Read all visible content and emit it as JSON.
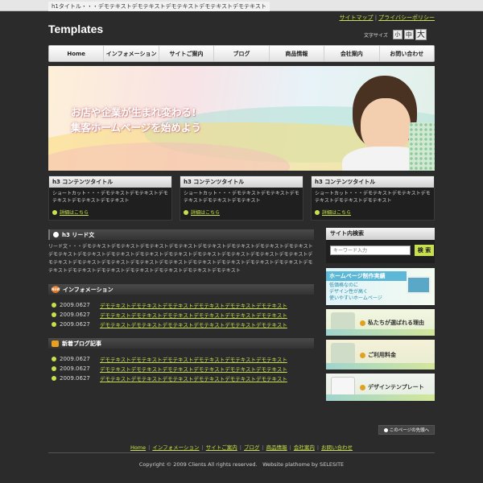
{
  "top_bar": {
    "h1_text": "h1タイトル・・・デモテキストデモテキストデモテキストデモテキストデモテキスト"
  },
  "site": {
    "logo": "Templates"
  },
  "utility_links": {
    "sitemap": "サイトマップ",
    "privacy": "プライバシーポリシー",
    "separator": "|"
  },
  "font_size": {
    "label": "文字サイズ",
    "small": "小",
    "medium": "中",
    "large": "大"
  },
  "global_nav": [
    "Home",
    "インフォメーション",
    "サイトご案内",
    "ブログ",
    "商品情報",
    "会社案内",
    "お問い合わせ"
  ],
  "hero": {
    "line1": "お店や企業が生まれ変わる!",
    "line2": "集客ホームページを始めよう"
  },
  "content_boxes": [
    {
      "title": "h3 コンテンツタイトル",
      "text": "ショートカット・・・デモテキストデモテキストデモテキストデモテキストデモテキスト",
      "more": "詳細はこちら"
    },
    {
      "title": "h3 コンテンツタイトル",
      "text": "ショートカット・・・デモテキストデモテキストデモテキストデモテキストデモテキスト",
      "more": "詳細はこちら"
    },
    {
      "title": "h3 コンテンツタイトル",
      "text": "ショートカット・・・デモテキストデモテキストデモテキストデモテキストデモテキスト",
      "more": "詳細はこちら"
    }
  ],
  "lead": {
    "heading": "h3 リード文",
    "text": "リード文・・・デモテキストデモテキストデモテキストデモテキストデモテキストデモテキストデモテキストデモテキストデモテキストデモテキストデモテキストデモテキストデモテキストデモテキストデモテキストデモテキストデモテキストデモテキストデモテキストデモテキストデモテキストデモテキストデモテキストデモテキストデモテキストデモテキストデモテキストデモテキストデモテキストデモテキストデモテキストデモテキストデモテキスト"
  },
  "information": {
    "heading": "インフォメーション",
    "icon_text": "NEW",
    "items": [
      {
        "date": "2009.0627",
        "text": "デモテキストデモテキストデモテキストデモテキストデモテキストデモテキスト"
      },
      {
        "date": "2009.0627",
        "text": "デモテキストデモテキストデモテキストデモテキストデモテキストデモテキスト"
      },
      {
        "date": "2009.0627",
        "text": "デモテキストデモテキストデモテキストデモテキストデモテキストデモテキスト"
      }
    ]
  },
  "blog": {
    "heading": "新着ブログ記事",
    "items": [
      {
        "date": "2009.0627",
        "text": "デモテキストデモテキストデモテキストデモテキストデモテキストデモテキスト"
      },
      {
        "date": "2009.0627",
        "text": "デモテキストデモテキストデモテキストデモテキストデモテキストデモテキスト"
      },
      {
        "date": "2009.0627",
        "text": "デモテキストデモテキストデモテキストデモテキストデモテキストデモテキスト"
      }
    ]
  },
  "search": {
    "heading": "サイト内検索",
    "placeholder": "キーワード入力",
    "button": "検 索"
  },
  "banners": {
    "production": {
      "title": "ホームページ制作実績",
      "line1": "低価格なのに",
      "line2": "デザイン性が高く",
      "line3": "使いやすいホームページ"
    },
    "reasons": "私たちが選ばれる理由",
    "pricing": "ご利用料金",
    "templates": "デザインテンプレート"
  },
  "page_top": "このページの先頭へ",
  "footer_nav": [
    "Home",
    "インフォメーション",
    "サイトご案内",
    "ブログ",
    "商品情報",
    "会社案内",
    "お問い合わせ"
  ],
  "copyright": "Copyright © 2009 Clients All rights reserved.　Website plathome by SELESITE"
}
